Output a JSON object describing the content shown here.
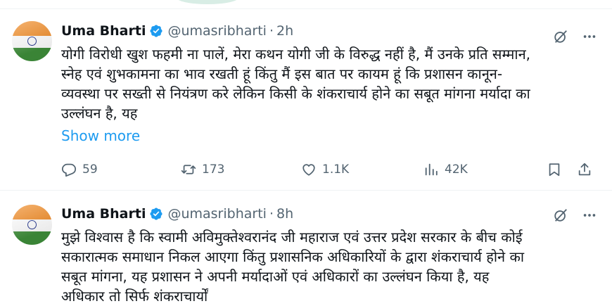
{
  "tweets": [
    {
      "author": "Uma Bharti",
      "handle": "@umasribharti",
      "separator": "·",
      "time": "2h",
      "text": "योगी विरोधी खुश फहमी ना पालें, मेरा कथन योगी जी के विरुद्ध नहीं है, मैं उनके प्रति सम्मान,\nस्नेह एवं शुभकामना का भाव रखती हूं किंतु मैं इस बात पर कायम हूं कि प्रशासन कानून-\nव्यवस्था पर सख्ती से नियंत्रण करे लेकिन किसी के शंकराचार्य होने का सबूत मांगना मर्यादा का\nउल्लंघन है, यह",
      "show_more": "Show more",
      "replies": "59",
      "reposts": "173",
      "likes": "1.1K",
      "views": "42K"
    },
    {
      "author": "Uma Bharti",
      "handle": "@umasribharti",
      "separator": "·",
      "time": "8h",
      "text": "मुझे विश्वास है कि स्वामी अविमुक्तेश्वरानंद जी महाराज एवं उत्तर प्रदेश सरकार के बीच कोई\nसकारात्मक समाधान निकल आएगा किंतु प्रशासनिक अधिकारियों के द्वारा शंकराचार्य होने का\nसबूत मांगना, यह प्रशासन ने अपनी मर्यादाओं एवं अधिकारों का उल्लंघन किया है,  यह\nअधिकार तो सिर्फ शंकराचार्यों"
    }
  ],
  "colors": {
    "link": "#1d9bf0",
    "verified": "#1d9bf0",
    "muted": "#536471",
    "text": "#0f1419"
  },
  "icons": [
    "verified-badge-icon",
    "grok-icon",
    "more-icon",
    "reply-icon",
    "retweet-icon",
    "like-icon",
    "views-icon",
    "bookmark-icon",
    "share-icon"
  ]
}
